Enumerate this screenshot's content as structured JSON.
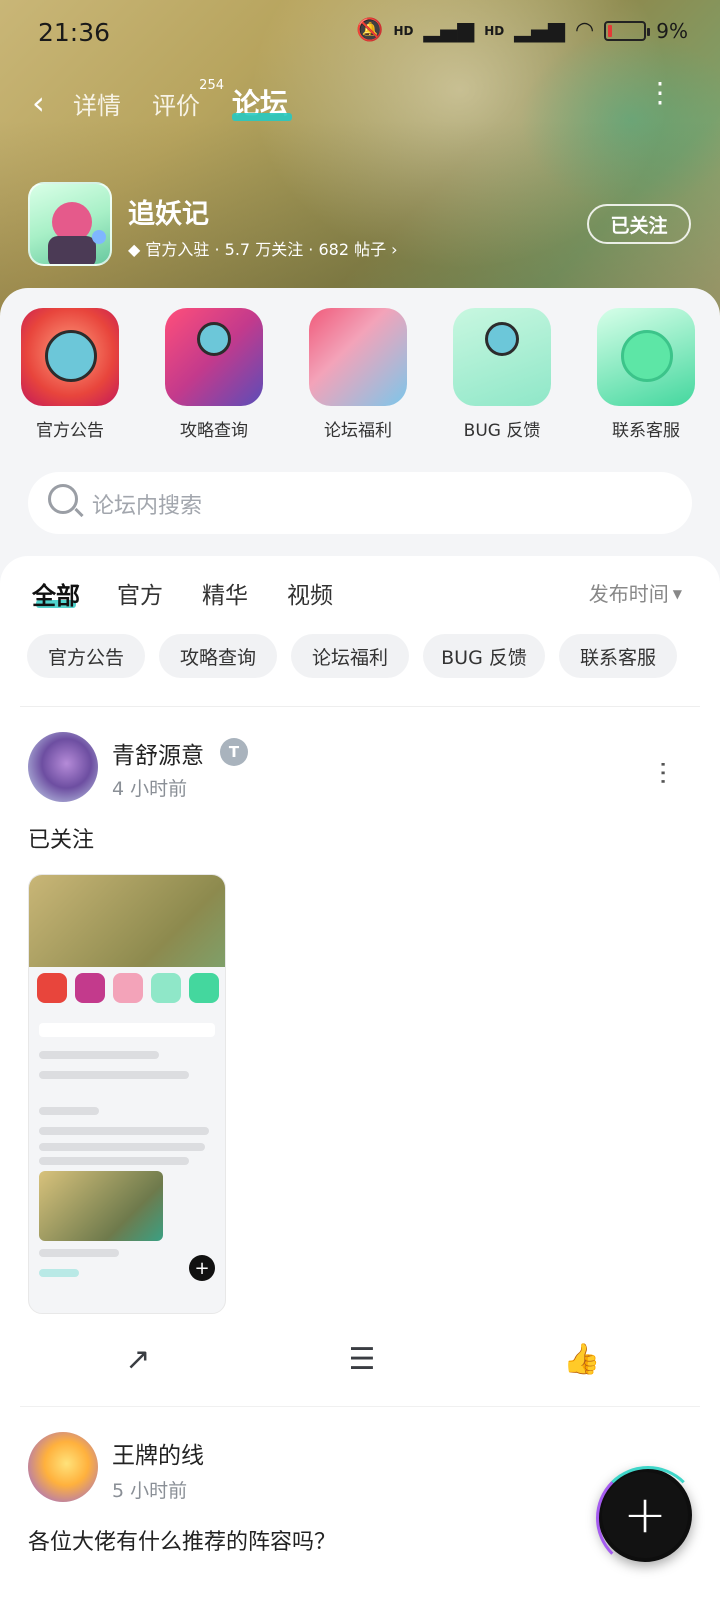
{
  "status_bar": {
    "time": "21:36",
    "battery_percent": "9",
    "signal_labels": [
      "HD",
      "HD"
    ]
  },
  "nav": {
    "tabs": [
      {
        "label": "详情",
        "badge": ""
      },
      {
        "label": "评价",
        "badge": "254"
      },
      {
        "label": "论坛",
        "badge": ""
      }
    ],
    "active_tab": "论坛"
  },
  "game": {
    "title": "追妖记",
    "meta": "官方入驻 · 5.7 万关注 · 682 帖子 ›",
    "follow_label": "已关注"
  },
  "quick_links": [
    {
      "label": "官方公告"
    },
    {
      "label": "攻略查询"
    },
    {
      "label": "论坛福利"
    },
    {
      "label": "BUG 反馈"
    },
    {
      "label": "联系客服"
    }
  ],
  "search": {
    "placeholder": "论坛内搜索"
  },
  "filter_tabs": [
    {
      "label": "全部"
    },
    {
      "label": "官方"
    },
    {
      "label": "精华"
    },
    {
      "label": "视频"
    }
  ],
  "sort_label": "发布时间",
  "chips": [
    {
      "label": "官方公告"
    },
    {
      "label": "攻略查询"
    },
    {
      "label": "论坛福利"
    },
    {
      "label": "BUG 反馈"
    },
    {
      "label": "联系客服"
    }
  ],
  "posts": [
    {
      "username": "青舒源意",
      "time": "4 小时前",
      "text": "已关注",
      "verified_glyph": "T"
    },
    {
      "username": "王牌的线",
      "time": "5 小时前",
      "text": "各位大佬有什么推荐的阵容吗？"
    }
  ],
  "fab_label": "+",
  "colors": {
    "accent": "#27c9c2",
    "banner": "#b7a45e",
    "fab": "#121212"
  }
}
